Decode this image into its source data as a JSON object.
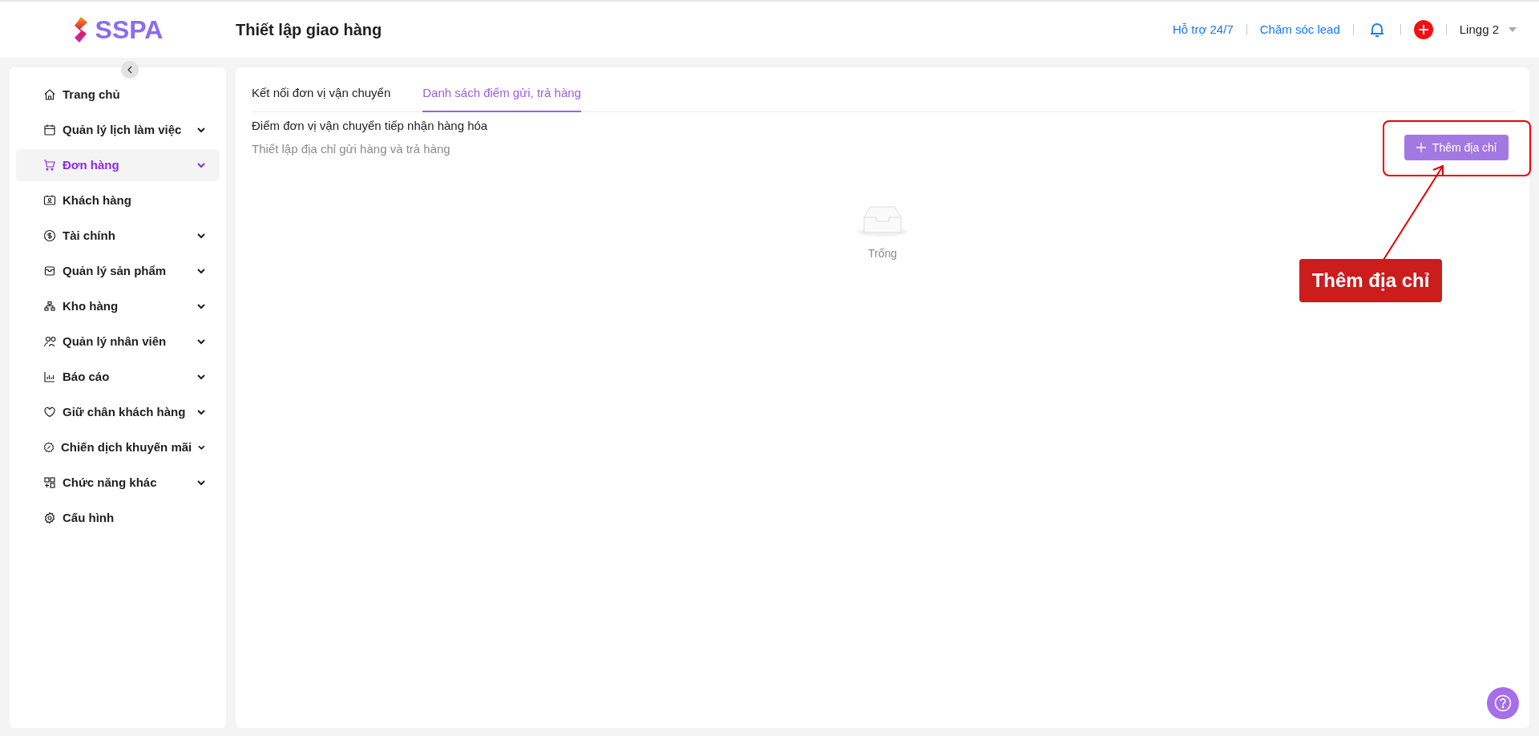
{
  "header": {
    "logo": "SSPA",
    "title": "Thiết lập giao hàng",
    "links": [
      "Hỗ trợ 24/7",
      "Chăm sóc lead"
    ],
    "user": "Lingg 2"
  },
  "sidebar": {
    "items": [
      {
        "label": "Trang chủ",
        "selected": false,
        "expandable": false
      },
      {
        "label": "Quản lý lịch làm việc",
        "selected": false,
        "expandable": true
      },
      {
        "label": "Đơn hàng",
        "selected": true,
        "expandable": true
      },
      {
        "label": "Khách hàng",
        "selected": false,
        "expandable": false
      },
      {
        "label": "Tài chính",
        "selected": false,
        "expandable": true
      },
      {
        "label": "Quản lý sản phẩm",
        "selected": false,
        "expandable": true
      },
      {
        "label": "Kho hàng",
        "selected": false,
        "expandable": true
      },
      {
        "label": "Quản lý nhân viên",
        "selected": false,
        "expandable": true
      },
      {
        "label": "Báo cáo",
        "selected": false,
        "expandable": true
      },
      {
        "label": "Giữ chân khách hàng",
        "selected": false,
        "expandable": true
      },
      {
        "label": "Chiến dịch khuyến mãi",
        "selected": false,
        "expandable": true
      },
      {
        "label": "Chức năng khác",
        "selected": false,
        "expandable": true
      },
      {
        "label": "Cấu hình",
        "selected": false,
        "expandable": false
      }
    ]
  },
  "tabs": [
    {
      "label": "Kết nối đơn vị vận chuyển",
      "selected": false
    },
    {
      "label": "Danh sách điểm gửi, trả hàng",
      "selected": true
    }
  ],
  "section_title": "Điểm đơn vị vận chuyển tiếp nhận hàng hóa",
  "section_hint": "Thiết lập địa chỉ gửi hàng và trả hàng",
  "add_button": "Thêm địa chỉ",
  "empty_state": "Trống",
  "annotation": {
    "label": "Thêm địa chỉ"
  }
}
